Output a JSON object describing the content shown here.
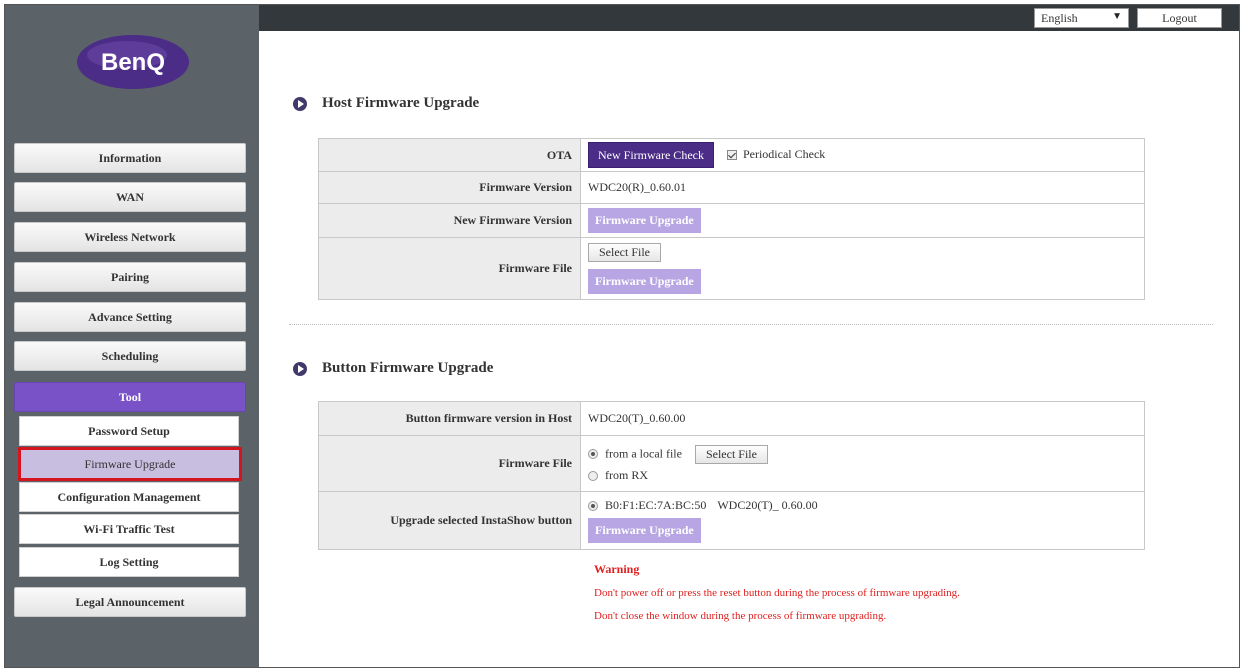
{
  "brand": {
    "logo_text": "BenQ",
    "logo_color": "#4b2c86"
  },
  "topbar": {
    "language": "English",
    "logout_label": "Logout"
  },
  "sidebar": {
    "items": [
      {
        "label": "Information"
      },
      {
        "label": "WAN"
      },
      {
        "label": "Wireless Network"
      },
      {
        "label": "Pairing"
      },
      {
        "label": "Advance Setting"
      },
      {
        "label": "Scheduling"
      },
      {
        "label": "Tool"
      },
      {
        "label": "Legal Announcement"
      }
    ],
    "tool_subitems": [
      {
        "label": "Password Setup"
      },
      {
        "label": "Firmware Upgrade"
      },
      {
        "label": "Configuration Management"
      },
      {
        "label": "Wi-Fi Traffic Test"
      },
      {
        "label": "Log Setting"
      }
    ]
  },
  "host": {
    "title": "Host Firmware Upgrade",
    "ota_label": "OTA",
    "check_button": "New Firmware Check",
    "periodical_label": "Periodical Check",
    "firmware_version_label": "Firmware Version",
    "firmware_version_value": "WDC20(R)_0.60.01",
    "new_version_label": "New Firmware Version",
    "upgrade_button": "Firmware Upgrade",
    "file_label": "Firmware File",
    "select_file": "Select File"
  },
  "button": {
    "title": "Button Firmware Upgrade",
    "version_label": "Button firmware version in Host",
    "version_value": "WDC20(T)_0.60.00",
    "file_label": "Firmware File",
    "local_file_label": "from a local file",
    "select_file": "Select File",
    "from_rx_label": "from RX",
    "upgrade_selected_label": "Upgrade selected InstaShow button",
    "device_mac": "B0:F1:EC:7A:BC:50",
    "device_version": "WDC20(T)_ 0.60.00",
    "upgrade_button": "Firmware Upgrade"
  },
  "warning": {
    "title": "Warning",
    "line1": "Don't power off or press the reset button during the process of firmware upgrading.",
    "line2": "Don't close the window during the process of firmware upgrading."
  },
  "colors": {
    "accent": "#7a52c7",
    "dark_purple": "#4b2c86",
    "disabled": "#b7a6e3",
    "warning": "#e01e1e",
    "sidebar_bg": "#5b6268"
  }
}
